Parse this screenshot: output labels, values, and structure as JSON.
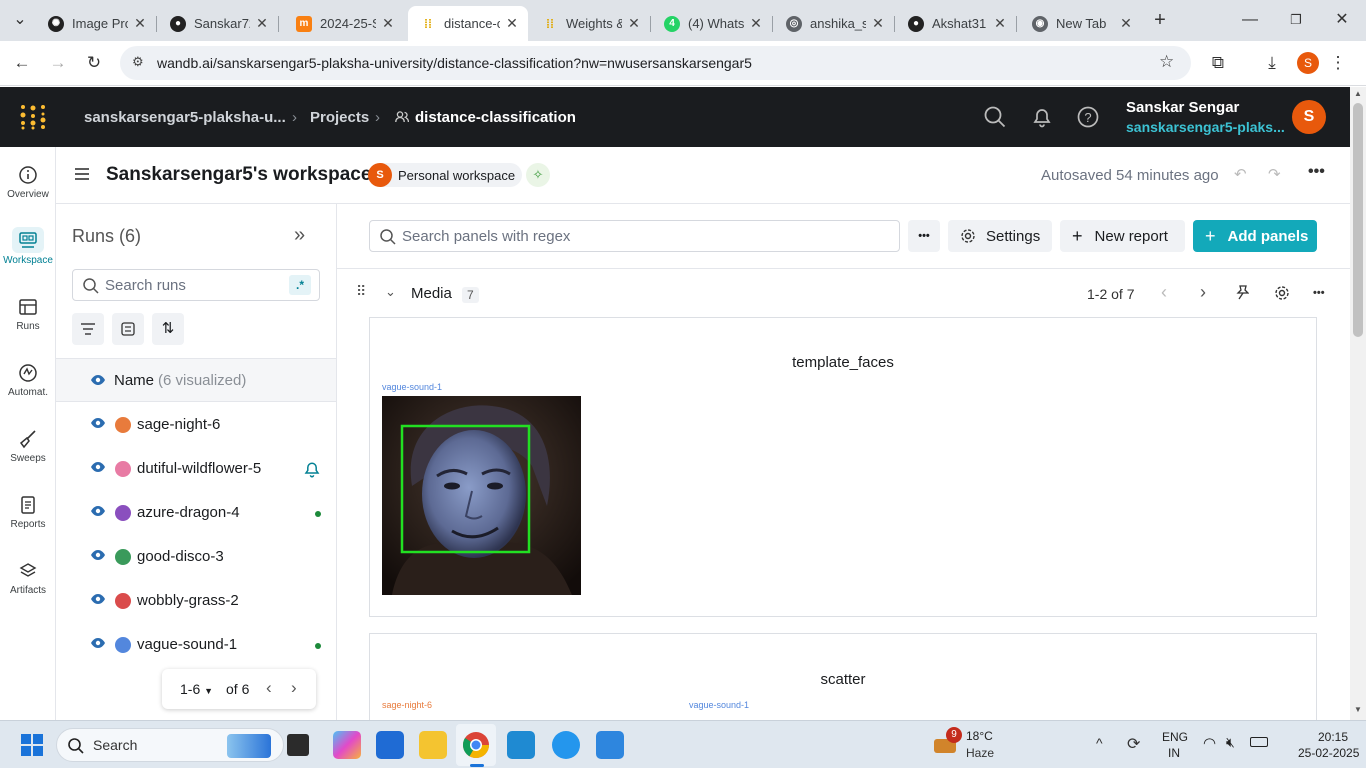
{
  "browser": {
    "tabs": [
      {
        "title": "Image Pro",
        "icon": "openai-icon",
        "color": "#222222"
      },
      {
        "title": "Sanskar72",
        "icon": "github-icon",
        "color": "#222222"
      },
      {
        "title": "2024-25-S",
        "icon": "moodle-icon",
        "color": "#f98012"
      },
      {
        "title": "distance-c",
        "icon": "wandb-icon",
        "color": "#ffcc33",
        "active": true
      },
      {
        "title": "Weights &",
        "icon": "wandb-icon",
        "color": "#ffcc33"
      },
      {
        "title": "(4) Whats",
        "icon": "whatsapp-icon",
        "color": "#25d366"
      },
      {
        "title": "anshika_s",
        "icon": "globe-icon",
        "color": "#5f6368"
      },
      {
        "title": "Akshat31",
        "icon": "github-icon",
        "color": "#222222"
      },
      {
        "title": "New Tab",
        "icon": "chrome-icon",
        "color": "#5f6368"
      }
    ],
    "url": "wandb.ai/sanskarsengar5-plaksha-university/distance-classification?nw=nwusersanskarsengar5",
    "profile_initial": "S"
  },
  "header": {
    "entity": "sanskarsengar5-plaksha-u...",
    "projects": "Projects",
    "project": "distance-classification",
    "user_name": "Sanskar Sengar",
    "user_entity": "sanskarsengar5-plaks...",
    "avatar": "S"
  },
  "rail": [
    {
      "label": "Overview",
      "icon": "info-icon"
    },
    {
      "label": "Workspace",
      "icon": "workspace-icon",
      "active": true
    },
    {
      "label": "Runs",
      "icon": "table-icon"
    },
    {
      "label": "Automat.",
      "icon": "automation-icon"
    },
    {
      "label": "Sweeps",
      "icon": "broom-icon"
    },
    {
      "label": "Reports",
      "icon": "report-icon"
    },
    {
      "label": "Artifacts",
      "icon": "layers-icon"
    }
  ],
  "workspace": {
    "title": "Sanskarsengar5's workspace",
    "badge_avatar": "S",
    "badge": "Personal workspace",
    "autosave": "Autosaved 54 minutes ago"
  },
  "runs": {
    "title": "Runs (6)",
    "search_placeholder": "Search runs",
    "regex": ".*",
    "column": "Name",
    "visualized": "(6 visualized)",
    "items": [
      {
        "name": "sage-night-6",
        "color": "#e87b3c"
      },
      {
        "name": "dutiful-wildflower-5",
        "color": "#e87ba4",
        "bell": true
      },
      {
        "name": "azure-dragon-4",
        "color": "#8a4fbe",
        "live": true
      },
      {
        "name": "good-disco-3",
        "color": "#3a9a5b"
      },
      {
        "name": "wobbly-grass-2",
        "color": "#da4c4c"
      },
      {
        "name": "vague-sound-1",
        "color": "#5387dd",
        "live": true
      }
    ],
    "pager": "1-6",
    "pager_of": "of 6"
  },
  "main": {
    "search_placeholder": "Search panels with regex",
    "settings": "Settings",
    "new_report": "New report",
    "add_panels": "Add panels",
    "section": "Media",
    "section_count": "7",
    "pagination": "1-2 of 7",
    "panels": [
      {
        "title": "template_faces",
        "run": "vague-sound-1"
      },
      {
        "title": "scatter",
        "runs": [
          "sage-night-6",
          "vague-sound-1"
        ]
      }
    ]
  },
  "taskbar": {
    "search": "Search",
    "weather_badge": "9",
    "temp": "18°C",
    "weather": "Haze",
    "lang1": "ENG",
    "lang2": "IN",
    "time": "20:15",
    "date": "25-02-2025"
  }
}
